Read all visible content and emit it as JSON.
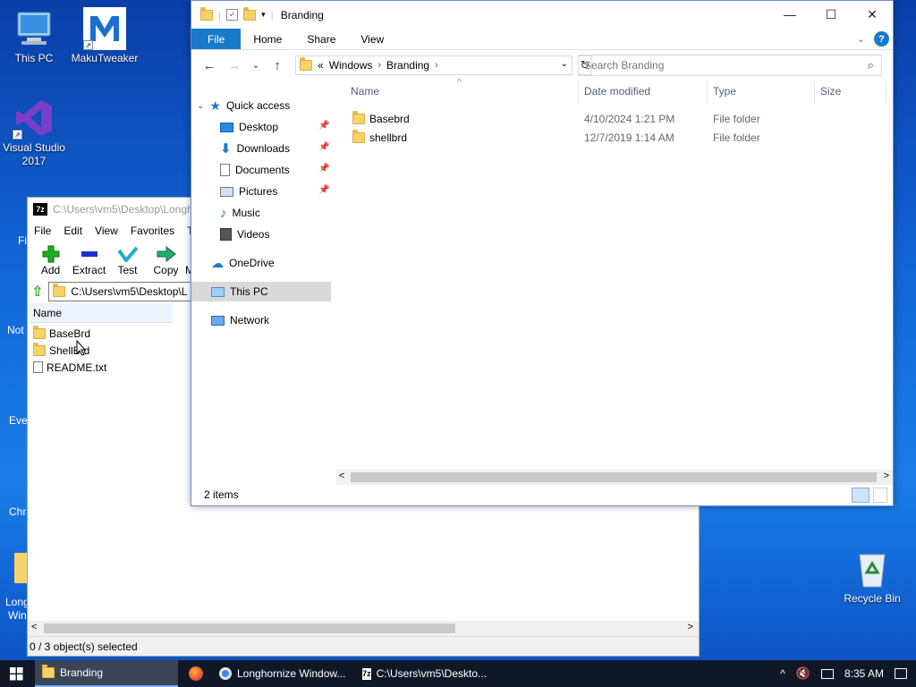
{
  "desktop": {
    "icons": [
      {
        "label": "This PC"
      },
      {
        "label": "MakuTweaker"
      },
      {
        "label": "Visual Studio 2017"
      },
      {
        "label": "Recycle Bin"
      }
    ],
    "partial_labels": [
      "Fi",
      "Not",
      "Eve",
      "Chr",
      "Long",
      "Win"
    ]
  },
  "zip": {
    "title": "C:\\Users\\vm5\\Desktop\\Longh",
    "menu": [
      "File",
      "Edit",
      "View",
      "Favorites",
      "To"
    ],
    "tools": [
      {
        "label": "Add",
        "icon": "plus-icon"
      },
      {
        "label": "Extract",
        "icon": "minus-icon"
      },
      {
        "label": "Test",
        "icon": "check-icon"
      },
      {
        "label": "Copy",
        "icon": "arrow-right-icon"
      },
      {
        "label": "M",
        "icon": "move-icon"
      }
    ],
    "address": "C:\\Users\\vm5\\Desktop\\L",
    "column": "Name",
    "items": [
      {
        "name": "BaseBrd",
        "type": "folder"
      },
      {
        "name": "ShellBrd",
        "type": "folder"
      },
      {
        "name": "README.txt",
        "type": "file"
      }
    ],
    "status": "0 / 3 object(s) selected"
  },
  "explorer": {
    "title": "Branding",
    "tabs": [
      "File",
      "Home",
      "Share",
      "View"
    ],
    "breadcrumb": [
      "«",
      "Windows",
      "Branding"
    ],
    "search_placeholder": "Search Branding",
    "nav": {
      "quick_access": "Quick access",
      "pinned": [
        {
          "label": "Desktop",
          "icon": "desktop-icon"
        },
        {
          "label": "Downloads",
          "icon": "download-icon"
        },
        {
          "label": "Documents",
          "icon": "document-icon"
        },
        {
          "label": "Pictures",
          "icon": "picture-icon"
        }
      ],
      "other": [
        {
          "label": "Music",
          "icon": "music-icon"
        },
        {
          "label": "Videos",
          "icon": "video-icon"
        }
      ],
      "onedrive": "OneDrive",
      "this_pc": "This PC",
      "network": "Network"
    },
    "columns": [
      "Name",
      "Date modified",
      "Type",
      "Size"
    ],
    "files": [
      {
        "name": "Basebrd",
        "date": "4/10/2024 1:21 PM",
        "type": "File folder"
      },
      {
        "name": "shellbrd",
        "date": "12/7/2019 1:14 AM",
        "type": "File folder"
      }
    ],
    "status": "2 items"
  },
  "taskbar": {
    "items": [
      {
        "label": "Branding",
        "active": true
      },
      {
        "label": "",
        "icon": "firefox-icon"
      },
      {
        "label": "Longhornize Window...",
        "icon": "chrome-icon"
      },
      {
        "label": "C:\\Users\\vm5\\Deskto...",
        "icon": "7zip-icon"
      }
    ],
    "time": "8:35 AM"
  },
  "colors": {
    "accent": "#1979ca",
    "desktop": "#1266d6",
    "taskbar": "#101828"
  }
}
